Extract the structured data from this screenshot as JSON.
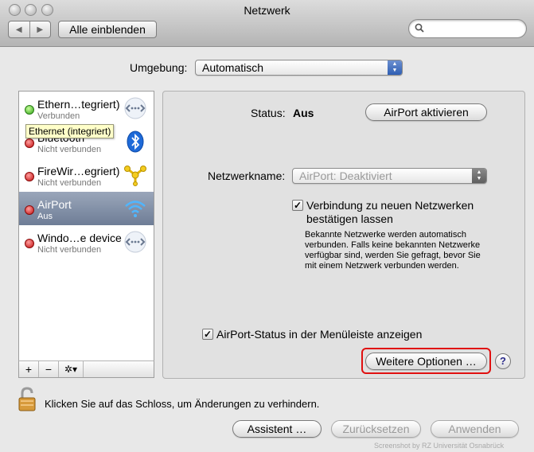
{
  "window": {
    "title": "Netzwerk"
  },
  "toolbar": {
    "show_all": "Alle einblenden",
    "search_value": ""
  },
  "environment": {
    "label": "Umgebung:",
    "value": "Automatisch"
  },
  "services": [
    {
      "name": "Ethern…tegriert)",
      "status": "Verbunden",
      "indicator": "green",
      "icon": "ethernet-icon"
    },
    {
      "name": "Bluetooth",
      "status": "Nicht verbunden",
      "indicator": "red",
      "icon": "bluetooth-icon"
    },
    {
      "name": "FireWir…egriert)",
      "status": "Nicht verbunden",
      "indicator": "red",
      "icon": "firewire-icon"
    },
    {
      "name": "AirPort",
      "status": "Aus",
      "indicator": "red",
      "icon": "wifi-icon",
      "selected": true
    },
    {
      "name": "Windo…e device",
      "status": "Nicht verbunden",
      "indicator": "red",
      "icon": "ethernet-icon"
    }
  ],
  "tooltip": "Ethernet (integriert)",
  "list_toolbar": {
    "add": "+",
    "remove": "−",
    "gear": "✲▾"
  },
  "detail": {
    "status_label": "Status:",
    "status_value": "Aus",
    "airport_button": "AirPort aktivieren",
    "network_name_label": "Netzwerkname:",
    "network_name_value": "AirPort: Deaktiviert",
    "confirm_checkbox_label_line1": "Verbindung zu neuen Netzwerken",
    "confirm_checkbox_label_line2": "bestätigen lassen",
    "confirm_checked": true,
    "description": "Bekannte Netzwerke werden automatisch verbunden. Falls keine bekannten Netzwerke verfügbar sind, werden Sie gefragt, bevor Sie mit einem Netzwerk verbunden werden.",
    "menubar_checkbox_label": "AirPort-Status in der Menüleiste anzeigen",
    "menubar_checked": true,
    "more_options": "Weitere Optionen …",
    "help": "?"
  },
  "footer": {
    "lock_text": "Klicken Sie auf das Schloss, um Änderungen zu verhindern.",
    "assistant": "Assistent …",
    "reset": "Zurücksetzen",
    "apply": "Anwenden",
    "credit": "Screenshot by RZ Universität Osnabrück"
  },
  "colors": {
    "selection": "#7e8ca3",
    "highlight_border": "#e01010",
    "status_green": "#2fa315",
    "status_red": "#c20e0e"
  }
}
